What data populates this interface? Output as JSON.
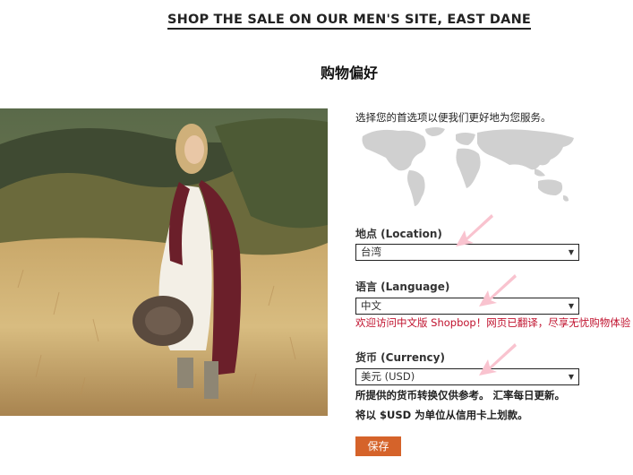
{
  "banner": {
    "text": "SHOP THE SALE ON OUR MEN'S SITE, EAST DANE"
  },
  "page": {
    "title": "购物偏好"
  },
  "preferences": {
    "intro": "选择您的首选项以便我们更好地为您服务。",
    "location": {
      "label": "地点 (Location)",
      "value": "台湾"
    },
    "language": {
      "label": "语言 (Language)",
      "value": "中文",
      "notice": "欢迎访问中文版 Shopbop！网页已翻译，尽享无忧购物体验"
    },
    "currency": {
      "label": "货币 (Currency)",
      "value": "美元 (USD)",
      "note_1": "所提供的货币转换仅供参考。 汇率每日更新。",
      "note_2": "将以 $USD 为单位从信用卡上划款。"
    },
    "save_label": "保存"
  },
  "colors": {
    "save_button": "#d5632a",
    "notice_text": "#c0122e",
    "arrow": "#f9c3cf",
    "map": "#d0d0d0"
  }
}
